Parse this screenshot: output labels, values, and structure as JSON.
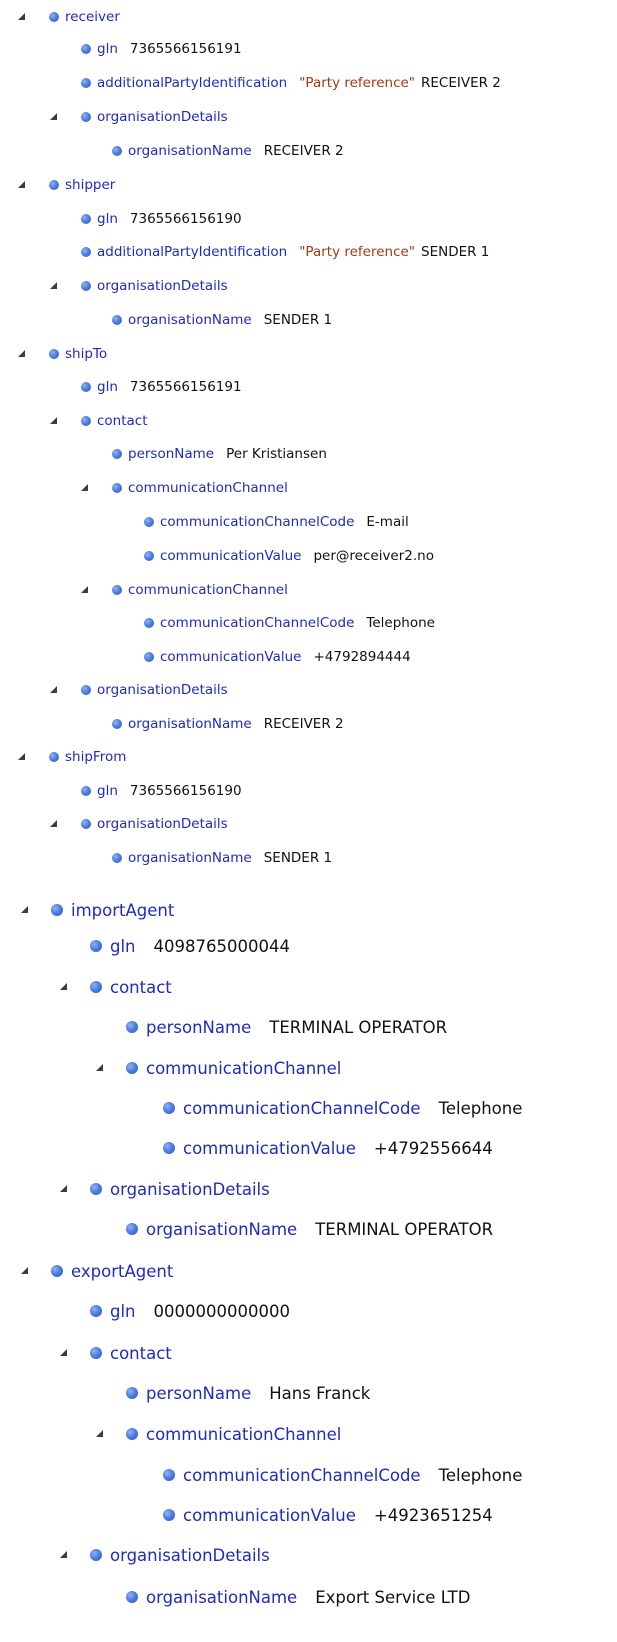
{
  "tree": [
    {
      "key": "receiver",
      "depth": 0,
      "size": 1,
      "expanded": true,
      "value": ""
    },
    {
      "key": "gln",
      "depth": 1,
      "size": 1,
      "value": "7365566156191"
    },
    {
      "key": "additionalPartyIdentification",
      "depth": 1,
      "size": 1,
      "quoted": "\"Party reference\"",
      "value": "RECEIVER 2"
    },
    {
      "key": "organisationDetails",
      "depth": 1,
      "size": 1,
      "expanded": true,
      "value": ""
    },
    {
      "key": "organisationName",
      "depth": 2,
      "size": 1,
      "value": "RECEIVER 2"
    },
    {
      "key": "shipper",
      "depth": 0,
      "size": 1,
      "expanded": true,
      "value": ""
    },
    {
      "key": "gln",
      "depth": 1,
      "size": 1,
      "value": "7365566156190"
    },
    {
      "key": "additionalPartyIdentification",
      "depth": 1,
      "size": 1,
      "quoted": "\"Party reference\"",
      "value": "SENDER 1"
    },
    {
      "key": "organisationDetails",
      "depth": 1,
      "size": 1,
      "expanded": true,
      "value": ""
    },
    {
      "key": "organisationName",
      "depth": 2,
      "size": 1,
      "value": "SENDER 1"
    },
    {
      "key": "shipTo",
      "depth": 0,
      "size": 1,
      "expanded": true,
      "value": ""
    },
    {
      "key": "gln",
      "depth": 1,
      "size": 1,
      "value": "7365566156191"
    },
    {
      "key": "contact",
      "depth": 1,
      "size": 1,
      "expanded": true,
      "value": ""
    },
    {
      "key": "personName",
      "depth": 2,
      "size": 1,
      "value": "Per Kristiansen"
    },
    {
      "key": "communicationChannel",
      "depth": 2,
      "size": 1,
      "expanded": true,
      "value": ""
    },
    {
      "key": "communicationChannelCode",
      "depth": 3,
      "size": 1,
      "value": "E-mail"
    },
    {
      "key": "communicationValue",
      "depth": 3,
      "size": 1,
      "value": "per@receiver2.no"
    },
    {
      "key": "communicationChannel",
      "depth": 2,
      "size": 1,
      "expanded": true,
      "value": ""
    },
    {
      "key": "communicationChannelCode",
      "depth": 3,
      "size": 1,
      "value": "Telephone"
    },
    {
      "key": "communicationValue",
      "depth": 3,
      "size": 1,
      "value": "+4792894444"
    },
    {
      "key": "organisationDetails",
      "depth": 1,
      "size": 1,
      "expanded": true,
      "value": ""
    },
    {
      "key": "organisationName",
      "depth": 2,
      "size": 1,
      "value": "RECEIVER 2"
    },
    {
      "key": "shipFrom",
      "depth": 0,
      "size": 1,
      "expanded": true,
      "value": ""
    },
    {
      "key": "gln",
      "depth": 1,
      "size": 1,
      "value": "7365566156190"
    },
    {
      "key": "organisationDetails",
      "depth": 1,
      "size": 1,
      "expanded": true,
      "value": ""
    },
    {
      "key": "organisationName",
      "depth": 2,
      "size": 1,
      "value": "SENDER 1"
    },
    {
      "key": "importAgent",
      "depth": 0,
      "size": 2,
      "expanded": true,
      "value": ""
    },
    {
      "key": "gln",
      "depth": 1,
      "size": 2,
      "value": "4098765000044"
    },
    {
      "key": "contact",
      "depth": 1,
      "size": 2,
      "expanded": true,
      "value": ""
    },
    {
      "key": "personName",
      "depth": 2,
      "size": 2,
      "value": "TERMINAL OPERATOR"
    },
    {
      "key": "communicationChannel",
      "depth": 2,
      "size": 2,
      "expanded": true,
      "value": ""
    },
    {
      "key": "communicationChannelCode",
      "depth": 3,
      "size": 2,
      "value": "Telephone"
    },
    {
      "key": "communicationValue",
      "depth": 3,
      "size": 2,
      "value": "+4792556644"
    },
    {
      "key": "organisationDetails",
      "depth": 1,
      "size": 2,
      "expanded": true,
      "value": ""
    },
    {
      "key": "organisationName",
      "depth": 2,
      "size": 2,
      "value": "TERMINAL OPERATOR"
    },
    {
      "key": "exportAgent",
      "depth": 0,
      "size": 2,
      "expanded": true,
      "value": ""
    },
    {
      "key": "gln",
      "depth": 1,
      "size": 2,
      "value": "0000000000000"
    },
    {
      "key": "contact",
      "depth": 1,
      "size": 2,
      "expanded": true,
      "value": ""
    },
    {
      "key": "personName",
      "depth": 2,
      "size": 2,
      "value": "Hans Franck"
    },
    {
      "key": "communicationChannel",
      "depth": 2,
      "size": 2,
      "expanded": true,
      "value": ""
    },
    {
      "key": "communicationChannelCode",
      "depth": 3,
      "size": 2,
      "value": "Telephone"
    },
    {
      "key": "communicationValue",
      "depth": 3,
      "size": 2,
      "value": "+4923651254"
    },
    {
      "key": "organisationDetails",
      "depth": 1,
      "size": 2,
      "expanded": true,
      "value": ""
    },
    {
      "key": "organisationName",
      "depth": 2,
      "size": 2,
      "value": "Export Service LTD"
    }
  ]
}
